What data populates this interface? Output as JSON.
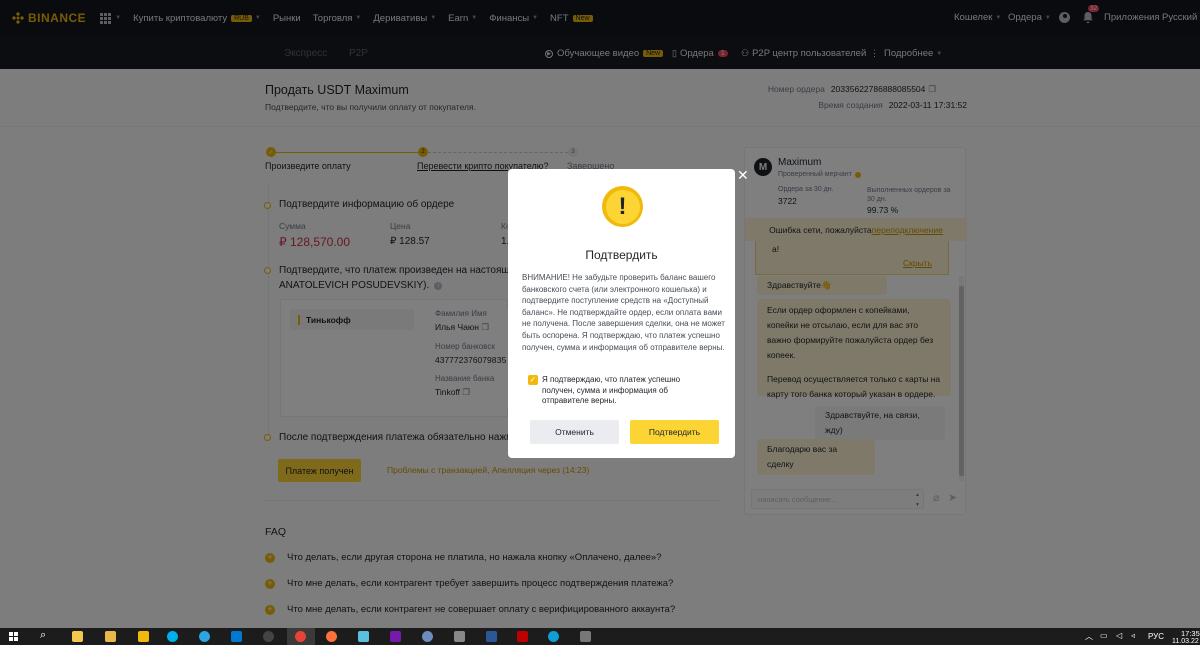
{
  "colors": {
    "brand": "#f0b90b",
    "accent": "#fcd535",
    "price_red": "#cf304a",
    "nav_bg": "#12161c"
  },
  "topnav": {
    "logo": "BINANCE",
    "items": [
      {
        "label": "Купить криптовалюту",
        "badge": "RUB"
      },
      {
        "label": "Рынки"
      },
      {
        "label": "Торговля"
      },
      {
        "label": "Деривативы"
      },
      {
        "label": "Earn"
      },
      {
        "label": "Финансы"
      },
      {
        "label": "NFT",
        "badge": "New"
      }
    ],
    "wallet": "Кошелек",
    "orders": "Ордера",
    "notifications_count": "32",
    "apps": "Приложения",
    "language": "Русский"
  },
  "subnav": {
    "tabs": [
      "Экспресс",
      "P2P"
    ],
    "video": "Обучающее видео",
    "video_badge": "New",
    "orders": "Ордера",
    "orders_badge": "1",
    "p2p_center": "P2P центр пользователей",
    "more": "Подробнее"
  },
  "order": {
    "title": "Продать USDT Maximum",
    "subtitle": "Подтвердите, что вы получили оплату от покупателя.",
    "number_label": "Номер ордера",
    "number": "20335622786888085504",
    "created_label": "Время создания",
    "created": "2022-03-11 17:31:52"
  },
  "steps": [
    {
      "num": "✓",
      "label": "Произведите оплату"
    },
    {
      "num": "2",
      "label": "Перевести крипто покупателю?"
    },
    {
      "num": "3",
      "label": "Завершено"
    }
  ],
  "confirm_info": {
    "heading": "Подтвердите информацию об ордере",
    "sum_label": "Сумма",
    "sum": "₽ 128,570.00",
    "price_label": "Цена",
    "price": "₽ 128.57",
    "qty_label": "Ко",
    "qty": "1."
  },
  "payment": {
    "heading": "Подтвердите, что платеж произведен на настояще",
    "heading_line2": "ANATOLEVICH POSUDEVSKIY).",
    "bank": "Тинькофф",
    "name_label": "Фамилия Имя",
    "name": "Илья Чаюн",
    "account_label": "Номер банковск",
    "account": "4377723760798З5",
    "bankname_label": "Название банка",
    "bankname": "Tinkoff"
  },
  "after": {
    "text": "После подтверждения платежа обязательно нажмит",
    "button": "Платеж получен",
    "problem_link": "Проблемы с транзакцией, Апелляция через (14:23)"
  },
  "faq": {
    "title": "FAQ",
    "items": [
      "Что делать, если другая сторона не платила, но нажала кнопку «Оплачено, далее»?",
      "Что мне делать, если контрагент требует завершить процесс подтверждения платежа?",
      "Что мне делать, если контрагент не совершает оплату с верифицированного аккаунта?"
    ]
  },
  "chat": {
    "avatar": "M",
    "name": "Maximum",
    "verified": "Проверенный мерчант",
    "stat1_label": "Ордера за 30 дн.",
    "stat1": "3722",
    "stat2_label": "Выполненных ордеров за 30 дн.",
    "stat2": "99.73 %",
    "error_text": "Ошибка сети, пожалуйста ",
    "error_link": "переподключение",
    "notice_fragment": "а!",
    "hide": "Скрыть",
    "messages": [
      {
        "dir": "in",
        "text": "Здравствуйте👋"
      },
      {
        "dir": "in",
        "text": "Если ордер оформлен с копейками, копейки не отсылаю, если для вас это важно формируйте пожалуйста ордер без копеек."
      },
      {
        "dir": "in",
        "text": "Перевод осуществляется только с карты на карту того банка который указан в ордере."
      },
      {
        "dir": "out",
        "text": "Здравствуйте, на связи, жду)"
      },
      {
        "dir": "in",
        "text": "Благодарю вас за сделку"
      }
    ],
    "placeholder": "написать сообщение..."
  },
  "modal": {
    "title": "Подтвердить",
    "warning": "ВНИМАНИЕ! Не забудьте проверить баланс вашего банковского счета (или электронного кошелька) и подтвердите поступление средств на «Доступный баланс». Не подтверждайте ордер, если оплата вами не получена. После завершения сделки, она не может быть оспорена. Я подтверждаю, что платеж успешно получен, сумма и информация об отправителе верны.",
    "checkbox": "Я подтверждаю, что платеж успешно получен, сумма и информация об отправителе верны.",
    "cancel": "Отменить",
    "confirm": "Подтвердить"
  },
  "taskbar": {
    "lang": "РУС",
    "time": "17:35",
    "date": "11.03.22"
  }
}
